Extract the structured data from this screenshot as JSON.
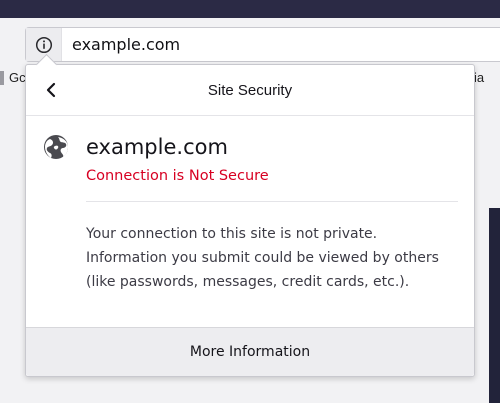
{
  "browser": {
    "url": "example.com",
    "bookmarks_left_fragment": "Gc",
    "bookmarks_right_fragment": "ia"
  },
  "panel": {
    "title": "Site Security",
    "site_name": "example.com",
    "status": "Connection is Not Secure",
    "description": "Your connection to this site is not private. Information you submit could be viewed by others (like passwords, messages, credit cards, etc.).",
    "more_info_label": "More Information"
  },
  "colors": {
    "status_red": "#d70022",
    "titlebar": "#2b2a45",
    "footer_bg": "#ededf0"
  },
  "icons": {
    "info": "info-icon",
    "back": "chevron-left-icon",
    "globe": "globe-icon"
  }
}
